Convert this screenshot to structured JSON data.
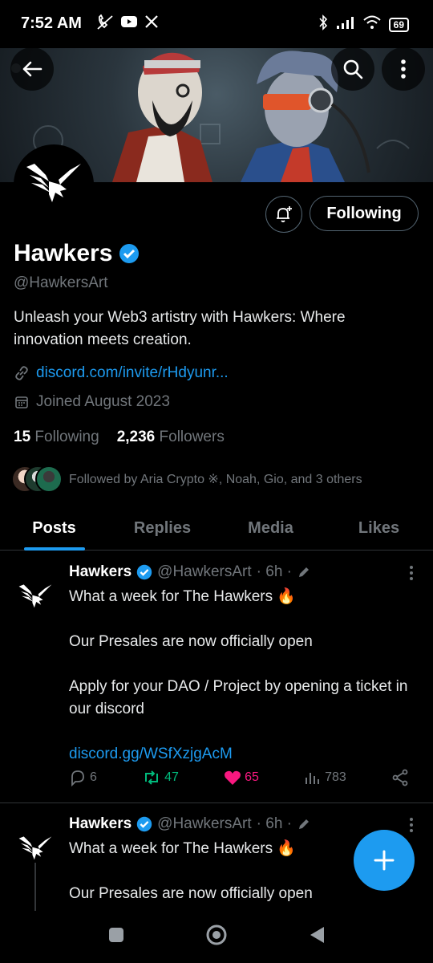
{
  "status_bar": {
    "time": "7:52 AM",
    "battery": "69"
  },
  "profile": {
    "name": "Hawkers",
    "handle": "@HawkersArt",
    "bio": "Unleash your Web3 artistry with Hawkers: Where innovation meets creation.",
    "link": "discord.com/invite/rHdyunr...",
    "joined": "Joined August 2023",
    "following_count": "15",
    "following_label": "Following",
    "followers_count": "2,236",
    "followers_label": "Followers",
    "followed_by": "Followed by Aria Crypto ※, Noah, Gio, and 3 others",
    "follow_button": "Following"
  },
  "tabs": [
    {
      "label": "Posts",
      "active": true
    },
    {
      "label": "Replies",
      "active": false
    },
    {
      "label": "Media",
      "active": false
    },
    {
      "label": "Likes",
      "active": false
    }
  ],
  "tweets": [
    {
      "name": "Hawkers",
      "handle": "@HawkersArt",
      "time": "· 6h ·",
      "line1": "What a week for The Hawkers 🔥",
      "line2": "Our Presales are now officially open",
      "line3": "Apply for your DAO / Project by opening a ticket in our discord",
      "link": "discord.gg/WSfXzjgAcM",
      "replies": "6",
      "reposts": "47",
      "likes": "65",
      "views": "783"
    },
    {
      "name": "Hawkers",
      "handle": "@HawkersArt",
      "time": "· 6h ·",
      "line1": "What a week for The Hawkers 🔥",
      "line2": "Our Presales are now officially open"
    }
  ],
  "colors": {
    "accent": "#1d9bf0",
    "repost": "#00ba7c",
    "like": "#f91880",
    "muted": "#71767b"
  }
}
